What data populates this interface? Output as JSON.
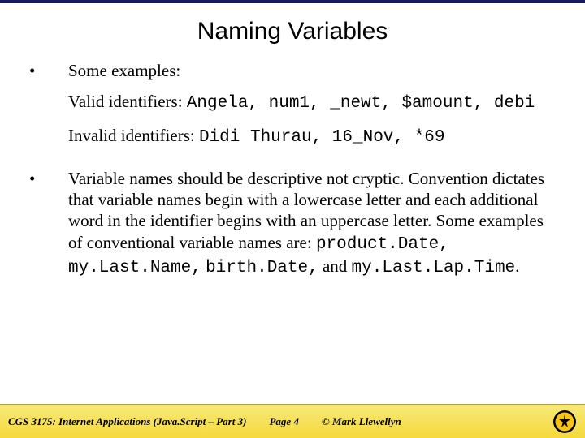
{
  "title": "Naming Variables",
  "bullets": {
    "b1": {
      "intro": "Some examples:",
      "valid_label": "Valid identifiers: ",
      "valid_code": "Angela, num1, _newt, $amount, debi",
      "invalid_label": "Invalid identifiers: ",
      "invalid_code": "Didi Thurau, 16_Nov, *69"
    },
    "b2": {
      "text_before": "Variable names should be descriptive not cryptic.  Convention dictates that variable names begin with a lowercase letter and each additional word in the identifier begins with an uppercase letter.  Some examples of conventional variable names are: ",
      "code1": "product.Date,",
      "spacer1": "  ",
      "code2": "my.Last.Name,",
      "spacer2": "  ",
      "code3": "birth.Date,",
      "spacer3": "  ",
      "text_and": "and ",
      "code4": "my.Last.Lap.Time",
      "period": "."
    }
  },
  "footer": {
    "course": "CGS 3175: Internet Applications (Java.Script – Part 3)",
    "page": "Page 4",
    "copyright": "© Mark Llewellyn"
  }
}
